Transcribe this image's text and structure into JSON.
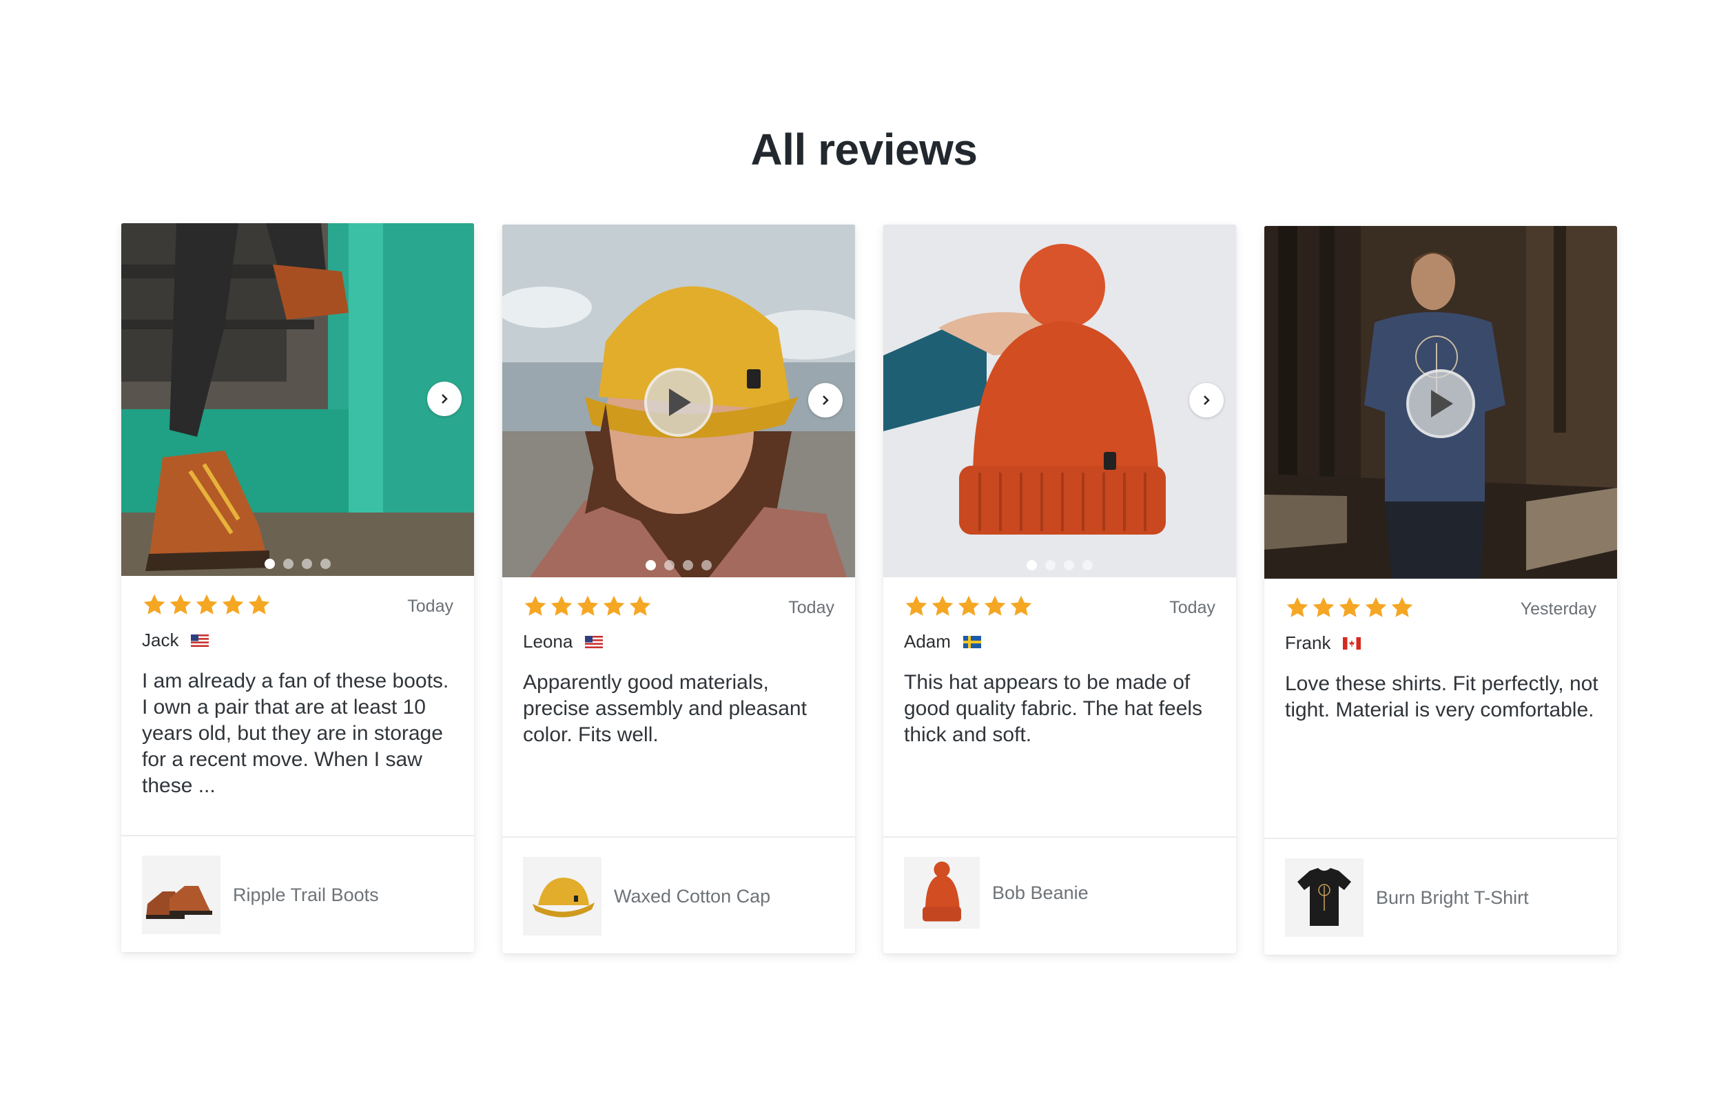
{
  "page": {
    "title": "All reviews"
  },
  "colors": {
    "star": "#f5a623",
    "heading": "#22282e"
  },
  "reviews": [
    {
      "rating": 5,
      "date": "Today",
      "author": "Jack",
      "flag": "us-flag-icon",
      "text": "I am already a fan of these boots. I own a pair that are at least 10 years old, but they are in storage for a recent move. When I saw these ...",
      "product": "Ripple Trail Boots",
      "media_type": "image",
      "slides": 4,
      "active_slide": 1
    },
    {
      "rating": 5,
      "date": "Today",
      "author": "Leona",
      "flag": "us-flag-icon",
      "text": "Apparently good materials, precise assembly and pleasant color. Fits well.",
      "product": "Waxed Cotton Cap",
      "media_type": "video",
      "slides": 4,
      "active_slide": 1
    },
    {
      "rating": 5,
      "date": "Today",
      "author": "Adam",
      "flag": "se-flag-icon",
      "text": "This hat appears to be made of good quality fabric. The hat feels thick and soft.",
      "product": "Bob Beanie",
      "media_type": "image",
      "slides": 4,
      "active_slide": 1
    },
    {
      "rating": 5,
      "date": "Yesterday",
      "author": "Frank",
      "flag": "ca-flag-icon",
      "text": "Love these shirts. Fit perfectly, not tight. Material is very comfortable.",
      "product": "Burn Bright T-Shirt",
      "media_type": "video",
      "slides": 1,
      "active_slide": 1
    }
  ]
}
